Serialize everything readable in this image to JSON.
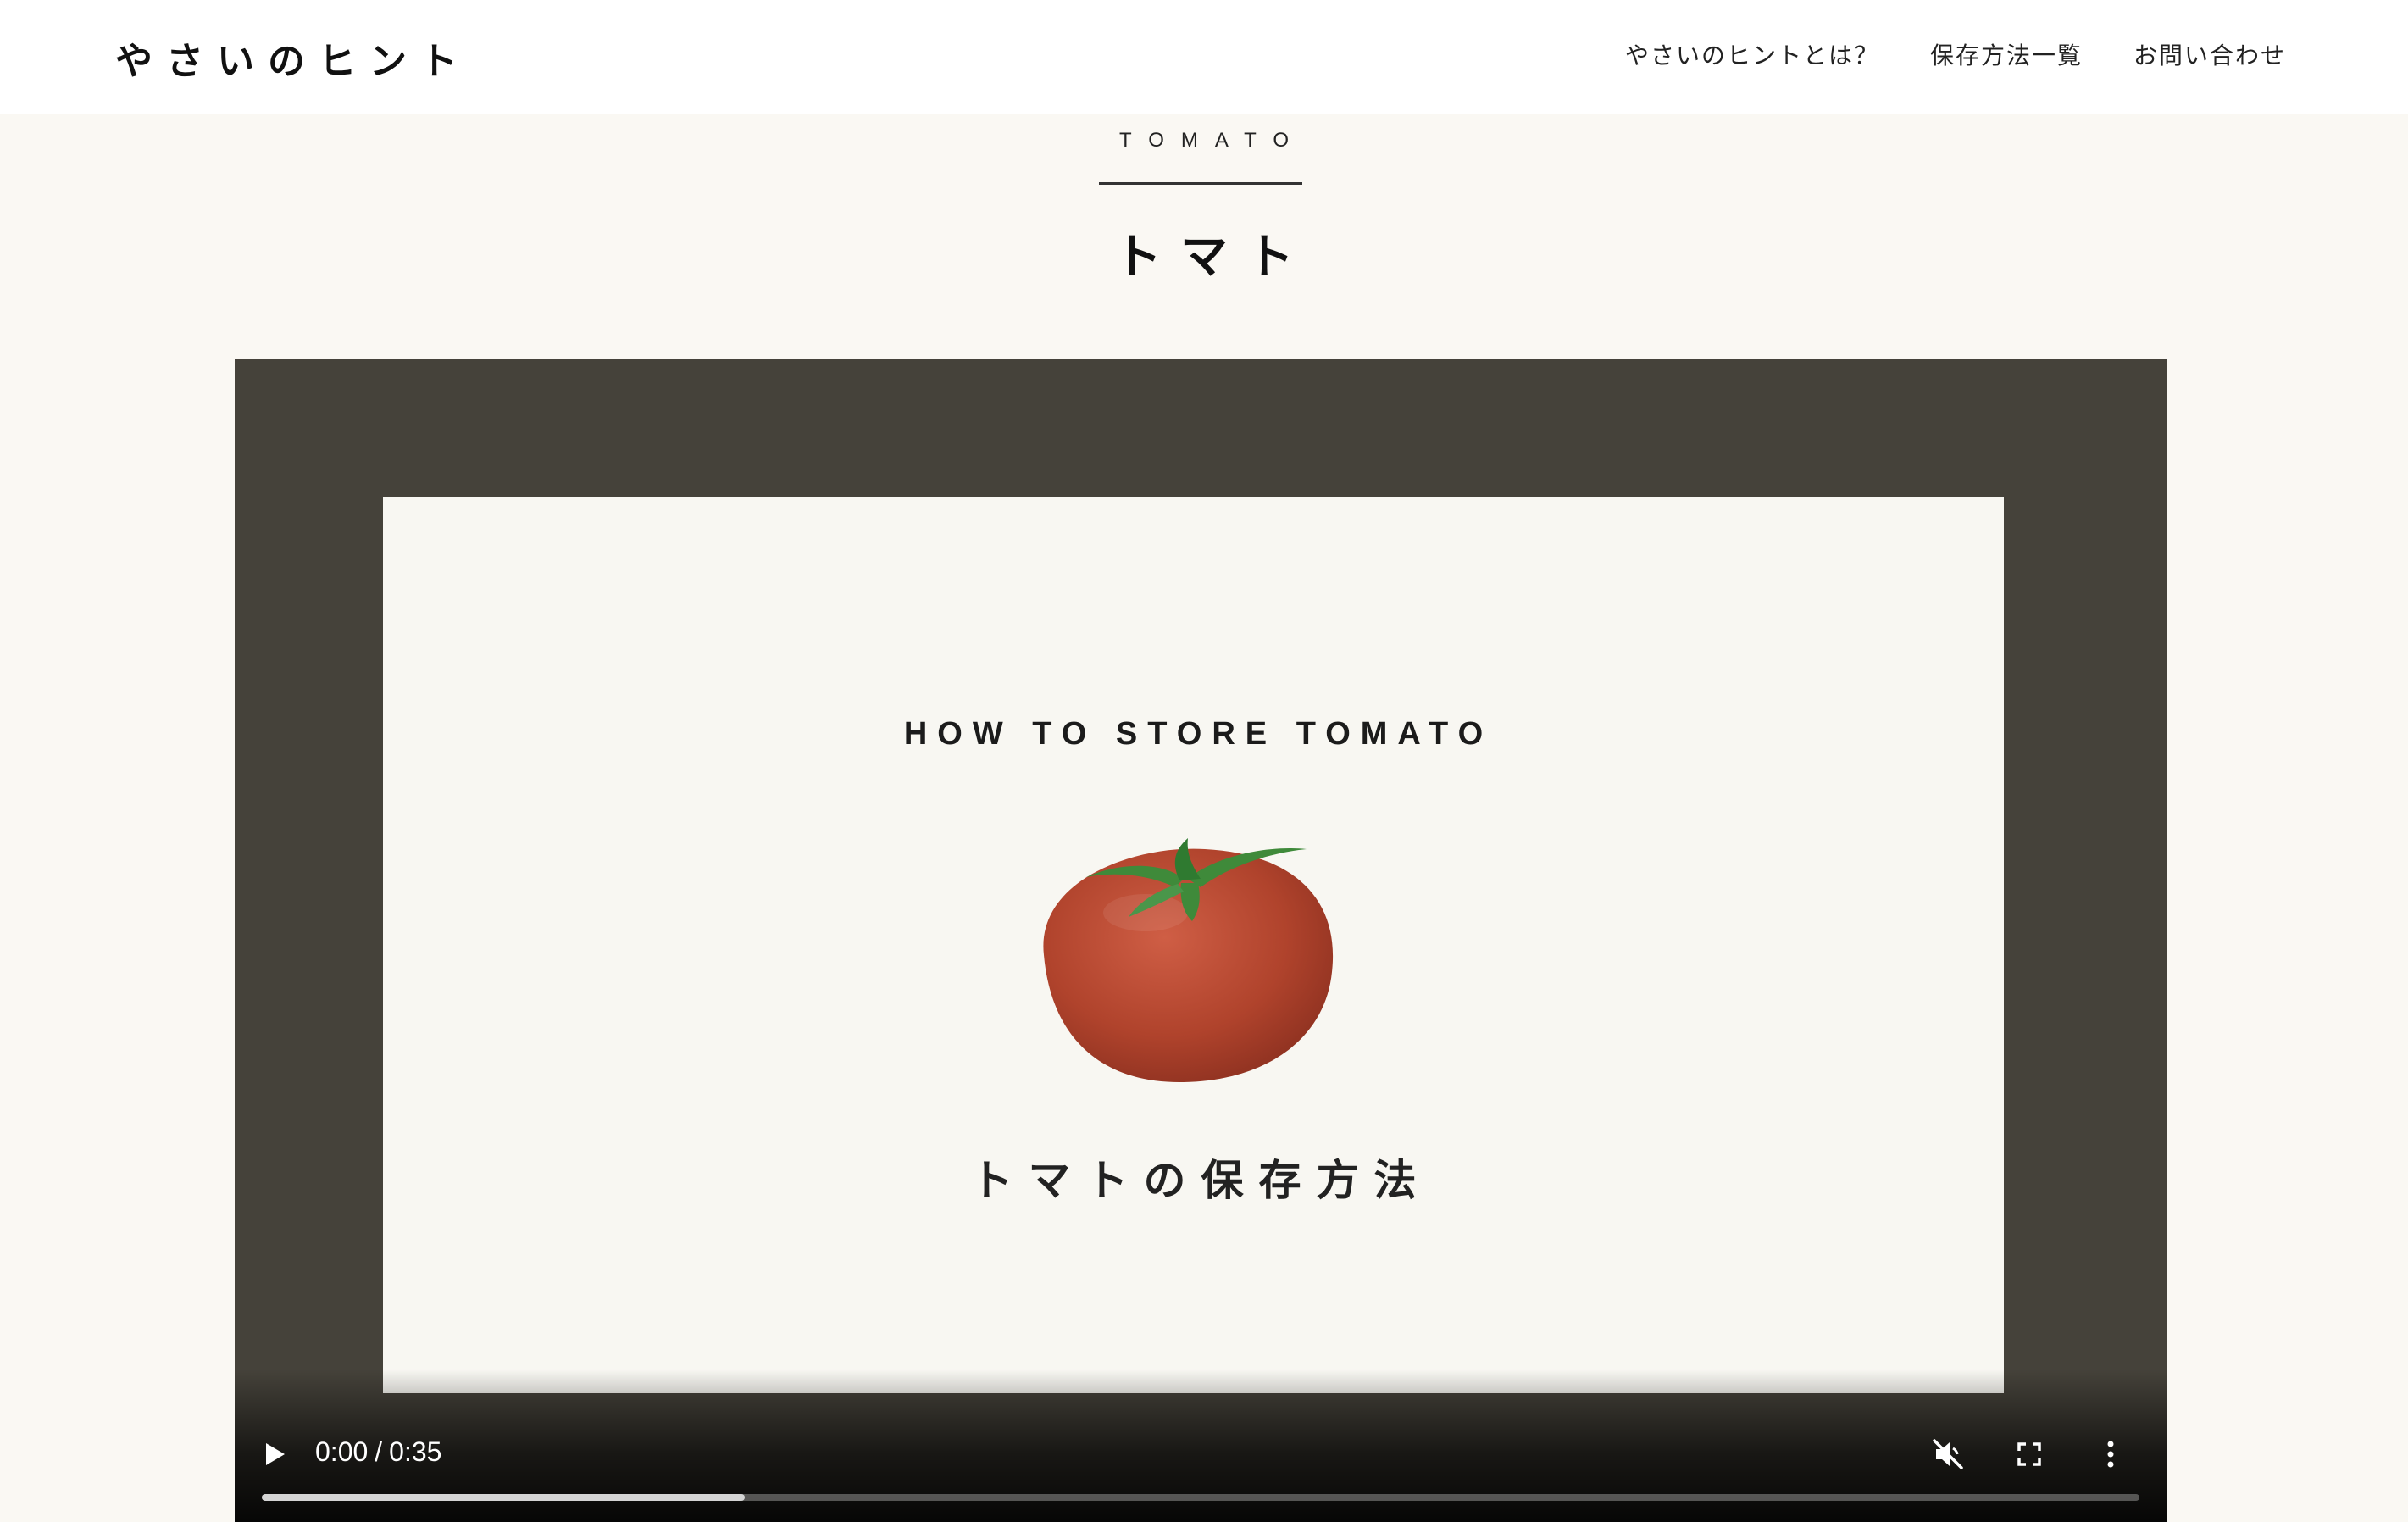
{
  "header": {
    "logo": "やさいのヒント",
    "nav": [
      "やさいのヒントとは？",
      "保存方法一覧",
      "お問い合わせ"
    ]
  },
  "section": {
    "eyebrow": "TOMATO",
    "title": "トマト"
  },
  "video": {
    "frame_heading": "HOW TO STORE TOMATO",
    "frame_caption": "トマトの保存方法",
    "current_time": "0:00",
    "separator": "/",
    "duration": "0:35",
    "buffered_fraction": 0.257,
    "muted": true,
    "icons": {
      "play": "play-icon",
      "mute": "volume-muted-icon",
      "fullscreen": "fullscreen-icon",
      "more": "more-vertical-icon"
    }
  },
  "colors": {
    "page_bg": "#faf8f3",
    "video_bg": "#45423a",
    "frame_bg": "#f8f7f2",
    "tomato": "#b84a33",
    "leaf": "#3f8a3a"
  }
}
